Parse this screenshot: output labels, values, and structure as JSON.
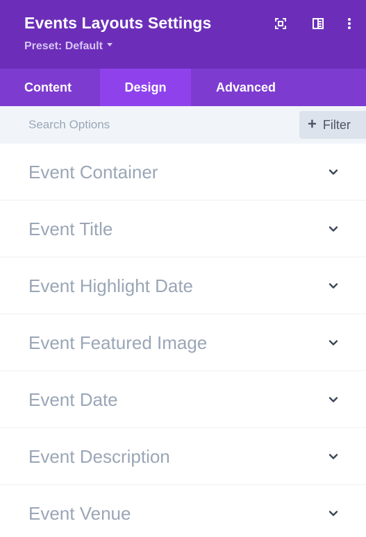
{
  "header": {
    "title": "Events Layouts Settings",
    "preset": "Preset: Default",
    "icons": [
      "focus-mode-icon",
      "sidebar-toggle-icon",
      "more-options-icon"
    ]
  },
  "tabs": [
    {
      "label": "Content",
      "active": false
    },
    {
      "label": "Design",
      "active": true
    },
    {
      "label": "Advanced",
      "active": false
    }
  ],
  "search": {
    "placeholder": "Search Options",
    "value": "",
    "filter_label": "Filter",
    "filter_icon": "plus-icon"
  },
  "groups": [
    {
      "label": "Event Container",
      "icon": "chevron-down-icon"
    },
    {
      "label": "Event Title",
      "icon": "chevron-down-icon"
    },
    {
      "label": "Event Highlight Date",
      "icon": "chevron-down-icon"
    },
    {
      "label": "Event Featured Image",
      "icon": "chevron-down-icon"
    },
    {
      "label": "Event Date",
      "icon": "chevron-down-icon"
    },
    {
      "label": "Event Description",
      "icon": "chevron-down-icon"
    },
    {
      "label": "Event Venue",
      "icon": "chevron-down-icon"
    }
  ],
  "colors": {
    "header_bg": "#6c2eb9",
    "tabs_bg": "#7e3bd0",
    "active_tab_bg": "#8f42ec",
    "search_bg": "#f1f5f9",
    "group_label": "#9aa6b6"
  }
}
